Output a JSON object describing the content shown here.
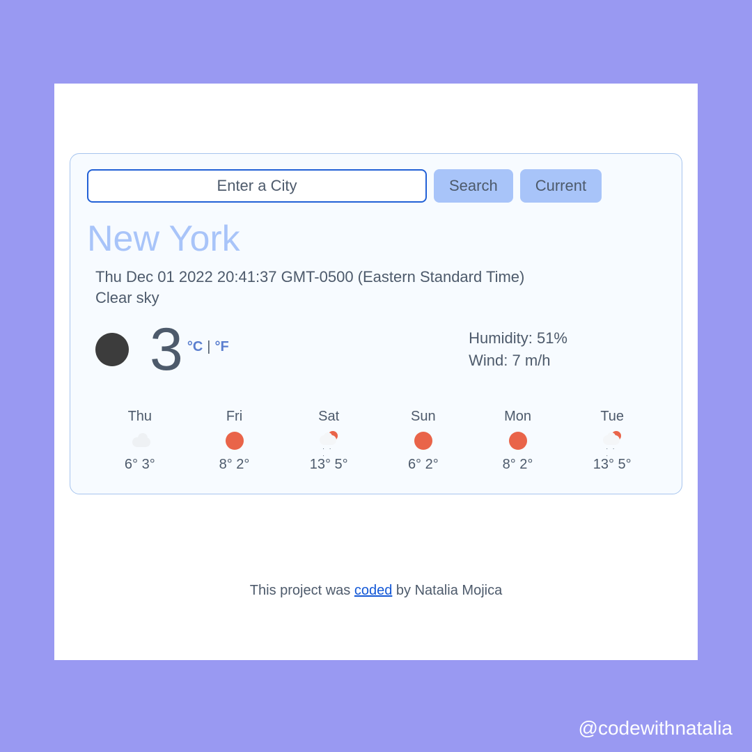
{
  "search": {
    "placeholder": "Enter a City",
    "search_label": "Search",
    "current_label": "Current"
  },
  "city": "New York",
  "datetime": "Thu Dec 01 2022 20:41:37 GMT-0500 (Eastern Standard Time)",
  "condition": "Clear sky",
  "current": {
    "temp": "3",
    "unit_c": "°C",
    "unit_sep": "|",
    "unit_f": "°F",
    "humidity_label": "Humidity: 51%",
    "wind_label": "Wind: 7 m/h",
    "icon": "moon-icon"
  },
  "forecast": [
    {
      "day": "Thu",
      "icon": "cloud",
      "high": "6°",
      "low": "3°"
    },
    {
      "day": "Fri",
      "icon": "sun",
      "high": "8°",
      "low": "2°"
    },
    {
      "day": "Sat",
      "icon": "rain",
      "high": "13°",
      "low": "5°"
    },
    {
      "day": "Sun",
      "icon": "sun",
      "high": "6°",
      "low": "2°"
    },
    {
      "day": "Mon",
      "icon": "sun",
      "high": "8°",
      "low": "2°"
    },
    {
      "day": "Tue",
      "icon": "rain",
      "high": "13°",
      "low": "5°"
    }
  ],
  "credit": {
    "prefix": "This project was ",
    "link_text": "coded",
    "suffix": " by Natalia Mojica"
  },
  "handle": "@codewithnatalia",
  "colors": {
    "page_bg": "#9999f2",
    "card_bg": "#ffffff",
    "panel_bg": "#f7fbff",
    "panel_border": "#a6c4ee",
    "accent_blue": "#a8c4f9",
    "input_border": "#2160d6",
    "text": "#4d5a6b",
    "sun": "#e96449"
  }
}
